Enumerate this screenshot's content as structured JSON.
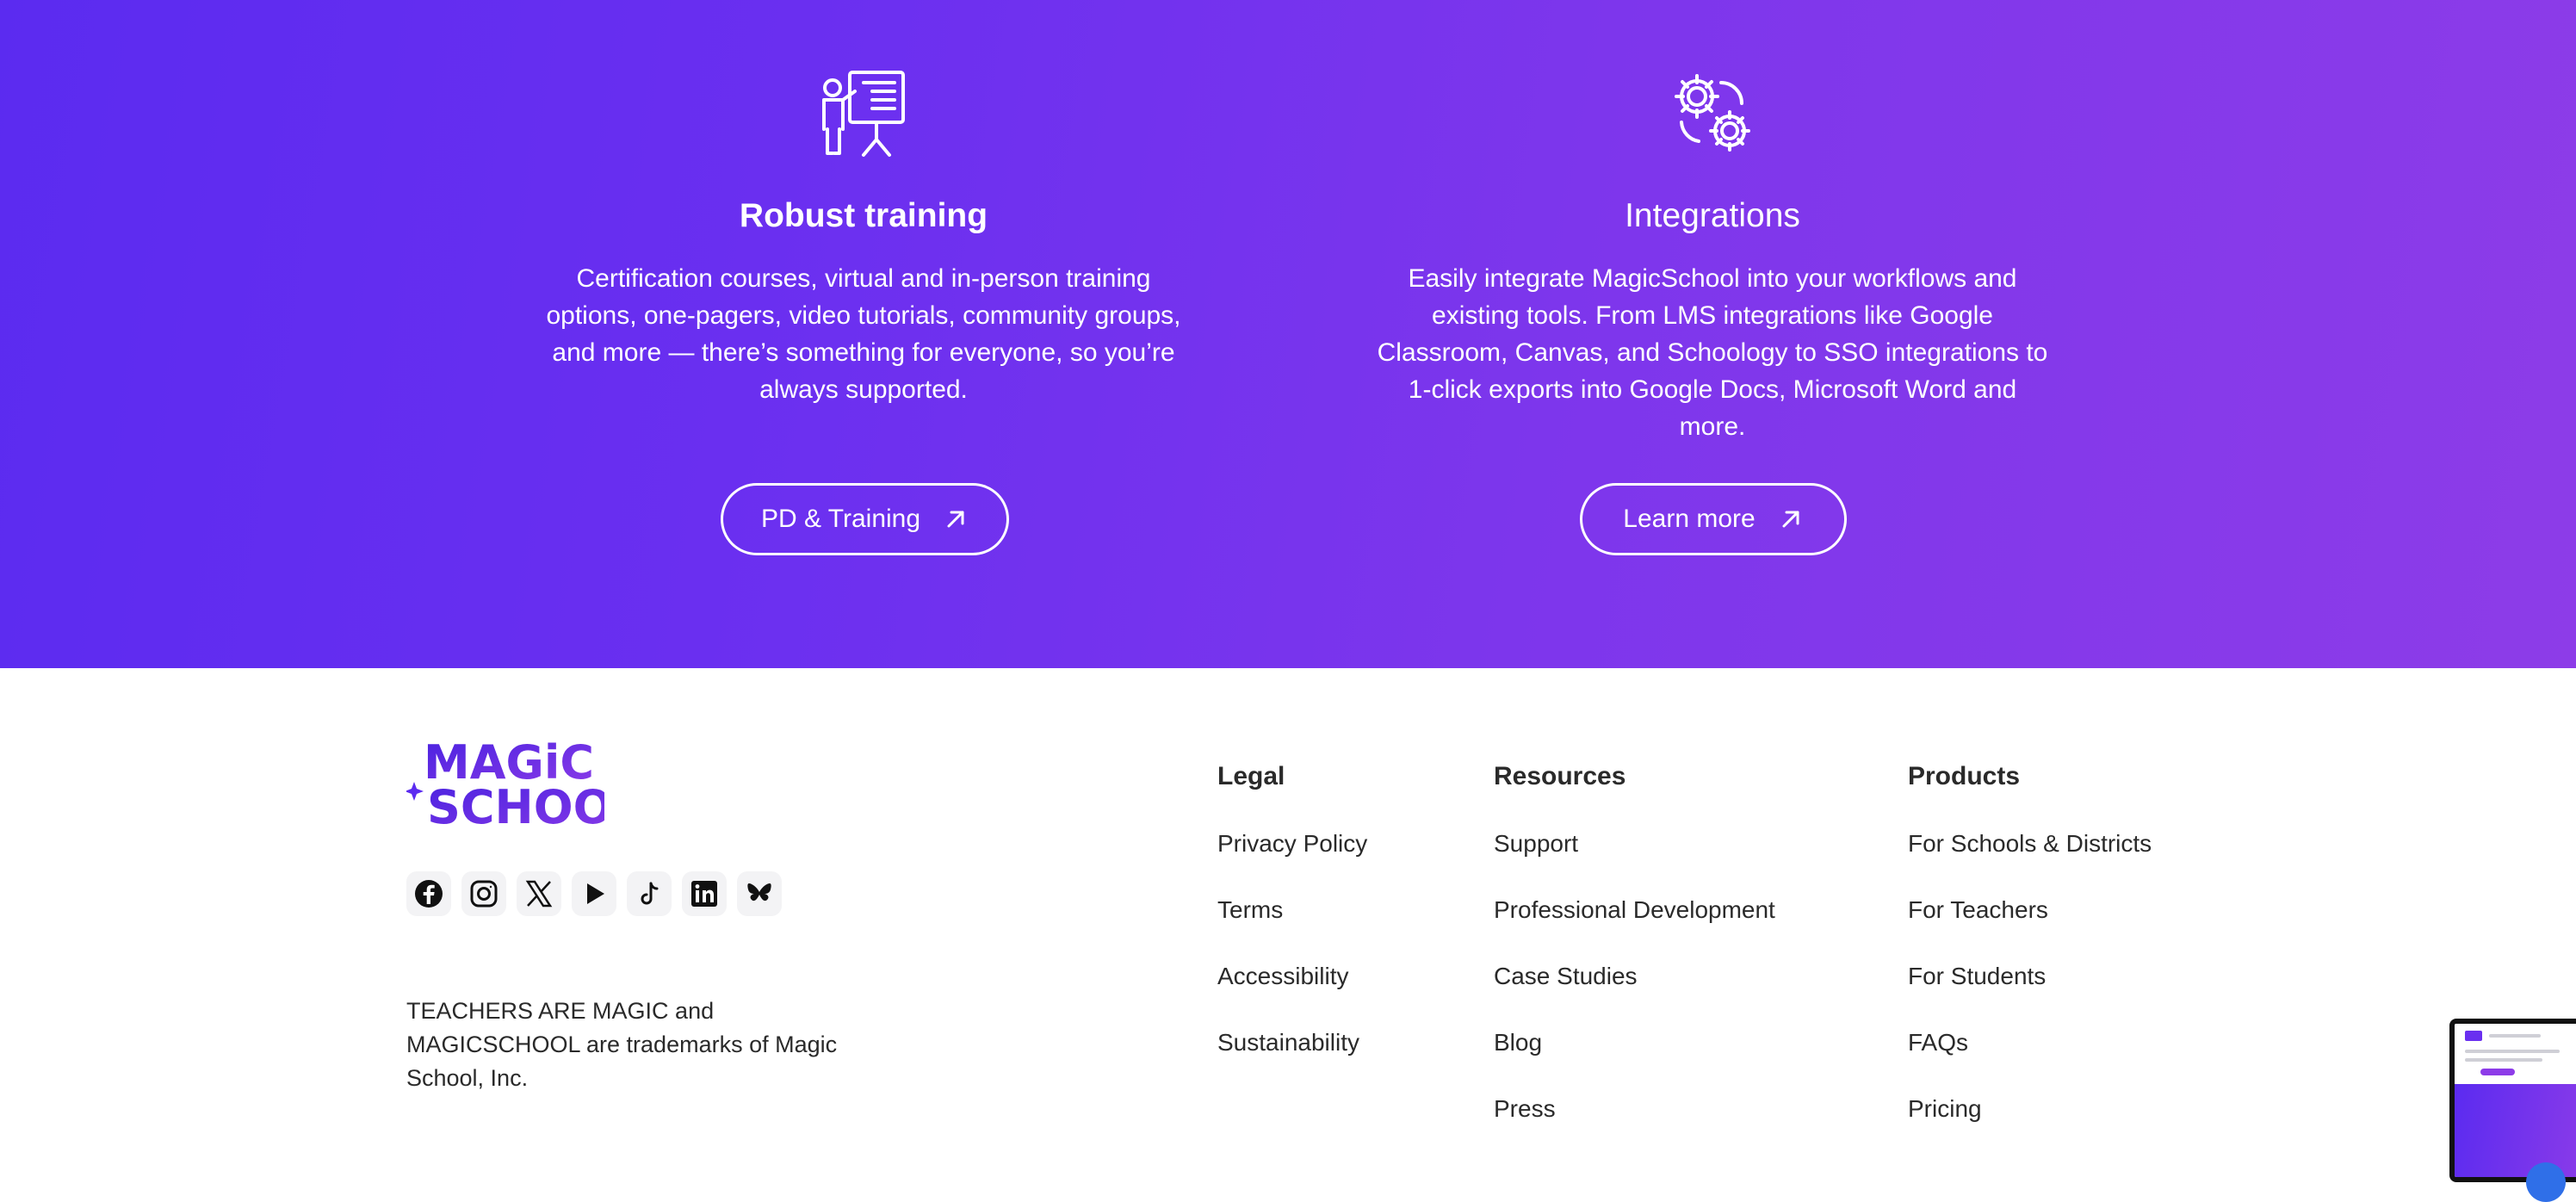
{
  "features": {
    "training": {
      "icon": "presentation-board-icon",
      "title": "Robust training",
      "description": "Certification courses, virtual and in-person training options, one-pagers, video tutorials, community groups, and more — there’s something for everyone, so you’re always supported.",
      "button_label": "PD & Training"
    },
    "integrations": {
      "icon": "gears-icon",
      "title": "Integrations",
      "description": "Easily integrate MagicSchool into your workflows and existing tools. From LMS integrations like Google Classroom, Canvas, and Schoology to SSO integrations to 1-click exports into Google Docs, Microsoft Word and more.",
      "button_label": "Learn more"
    }
  },
  "footer": {
    "logo": {
      "line1": "MAGiC",
      "line2": "SCHOOL"
    },
    "social": [
      "facebook-icon",
      "instagram-icon",
      "x-icon",
      "youtube-icon",
      "tiktok-icon",
      "linkedin-icon",
      "bluesky-icon"
    ],
    "trademark": "TEACHERS ARE MAGIC and MAGICSCHOOL are trademarks of Magic School, Inc.",
    "columns": {
      "legal": {
        "heading": "Legal",
        "links": [
          "Privacy Policy",
          "Terms",
          "Accessibility",
          "Sustainability"
        ]
      },
      "resources": {
        "heading": "Resources",
        "links": [
          "Support",
          "Professional Development",
          "Case Studies",
          "Blog",
          "Press"
        ]
      },
      "products": {
        "heading": "Products",
        "links": [
          "For Schools & Districts",
          "For Teachers",
          "For Students",
          "FAQs",
          "Pricing"
        ]
      }
    }
  },
  "colors": {
    "brand_purple": "#6a2ff0",
    "gradient_start": "#5b2bf0",
    "gradient_end": "#8d3ce8",
    "footer_text": "#2a2a2a"
  }
}
